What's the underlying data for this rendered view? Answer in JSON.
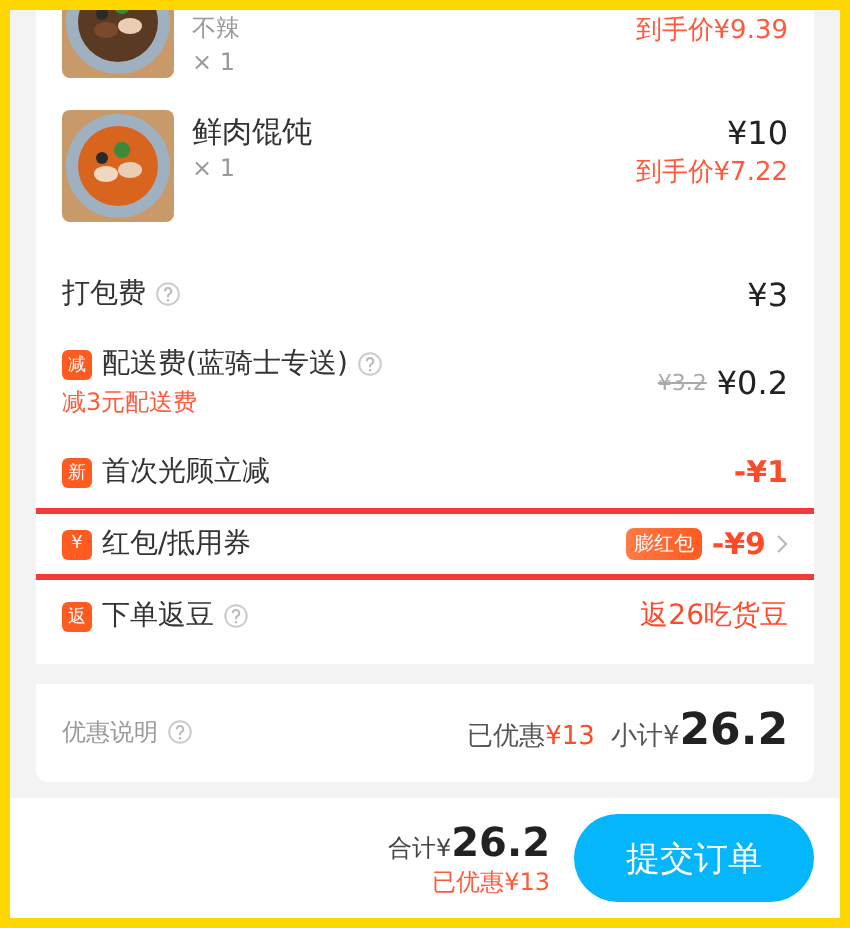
{
  "dishes": [
    {
      "spec": "不辣",
      "qty": "× 1",
      "final_price": "到手价¥9.39"
    },
    {
      "name": "鲜肉馄饨",
      "qty": "× 1",
      "price": "¥10",
      "final_price": "到手价¥7.22"
    }
  ],
  "fees": [
    {
      "kind": "plain",
      "label": "打包费",
      "help": true,
      "value": "¥3"
    },
    {
      "kind": "badge",
      "badge": "减",
      "label": "配送费(蓝骑士专送)",
      "help": true,
      "note": "减3元配送费",
      "old_value": "¥3.2",
      "value": "¥0.2"
    },
    {
      "kind": "badge",
      "badge": "新",
      "label": "首次光顾立减",
      "help": false,
      "value": "-¥1",
      "red": true
    },
    {
      "kind": "badge",
      "badge": "¥",
      "label": "红包/抵用券",
      "help": false,
      "tag": "膨红包",
      "value": "-¥9",
      "red": true,
      "chevron": true,
      "highlighted": true
    },
    {
      "kind": "badge",
      "badge": "返",
      "label": "下单返豆",
      "help": true,
      "value": "返26吃货豆",
      "red": true,
      "light": true
    }
  ],
  "summary": {
    "discount_note": "优惠说明",
    "saved_label": "已优惠",
    "saved": "¥13",
    "subtotal_label": "小计¥",
    "subtotal": "26.2"
  },
  "footer": {
    "total_label": "合计¥",
    "total": "26.2",
    "saved": "已优惠¥13",
    "submit": "提交订单"
  }
}
